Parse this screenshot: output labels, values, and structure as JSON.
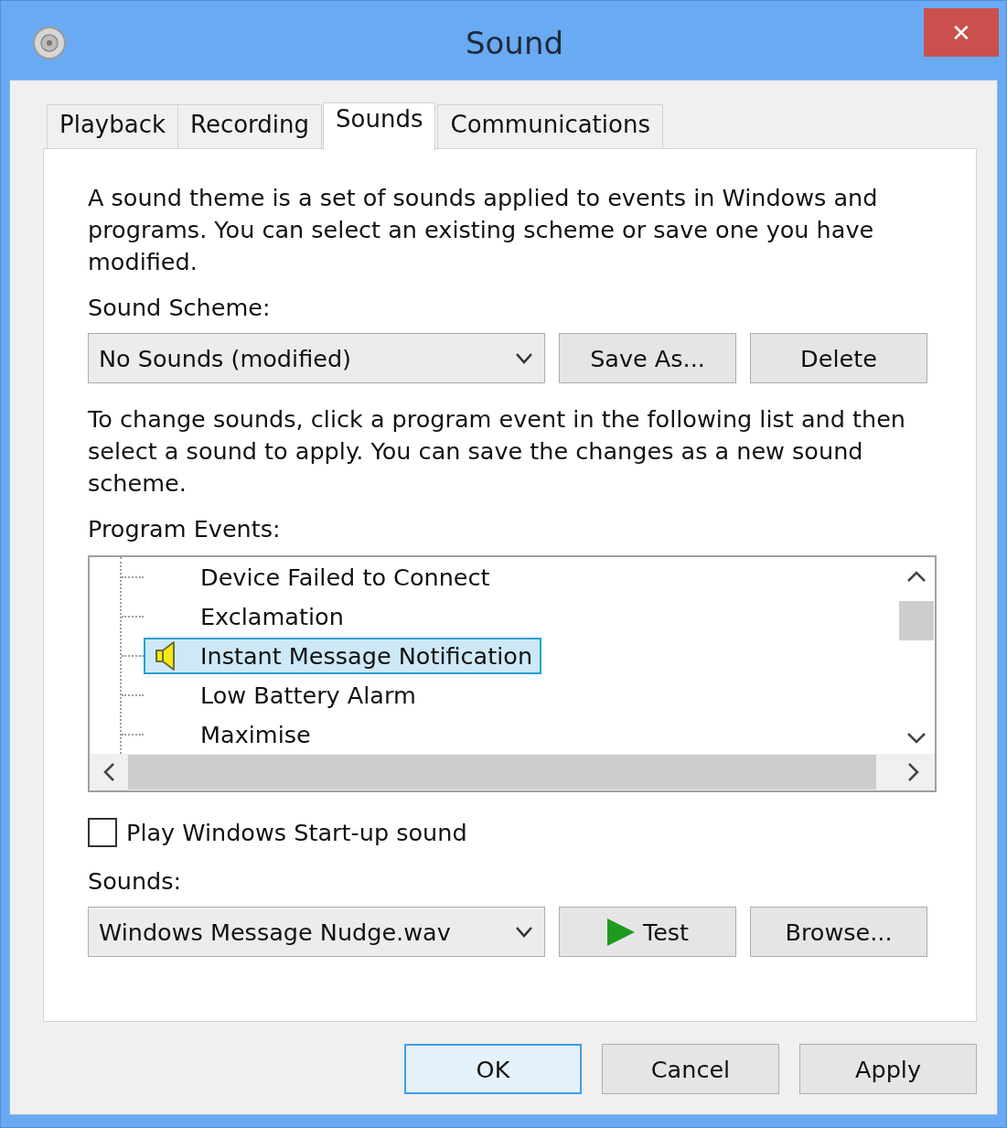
{
  "window": {
    "title": "Sound",
    "close": "✕"
  },
  "tabs": [
    {
      "label": "Playback",
      "selected": false
    },
    {
      "label": "Recording",
      "selected": false
    },
    {
      "label": "Sounds",
      "selected": true
    },
    {
      "label": "Communications",
      "selected": false
    }
  ],
  "description": "A sound theme is a set of sounds applied to events in Windows and programs.  You can select an existing scheme or save one you have modified.",
  "sound_scheme": {
    "label": "Sound Scheme:",
    "value": "No Sounds (modified)",
    "buttons": [
      "Save As...",
      "Delete"
    ]
  },
  "instructions": "To change sounds, click a program event in the following list and then select a sound to apply.  You can save the changes as a new sound scheme.",
  "program_events": {
    "label": "Program Events:",
    "items": [
      {
        "name": "Device Failed to Connect",
        "has_sound": false,
        "selected": false
      },
      {
        "name": "Exclamation",
        "has_sound": false,
        "selected": false
      },
      {
        "name": "Instant Message Notification",
        "has_sound": true,
        "selected": true
      },
      {
        "name": "Low Battery Alarm",
        "has_sound": false,
        "selected": false
      },
      {
        "name": "Maximise",
        "has_sound": false,
        "selected": false
      }
    ]
  },
  "startup_sound": {
    "label": "Play Windows Start-up sound",
    "checked": false
  },
  "sounds": {
    "label": "Sounds:",
    "value": "Windows Message Nudge.wav",
    "test": "Test",
    "browse": "Browse..."
  },
  "footer_buttons": [
    {
      "label": "OK",
      "default": true
    },
    {
      "label": "Cancel",
      "default": false
    },
    {
      "label": "Apply",
      "default": false
    }
  ]
}
